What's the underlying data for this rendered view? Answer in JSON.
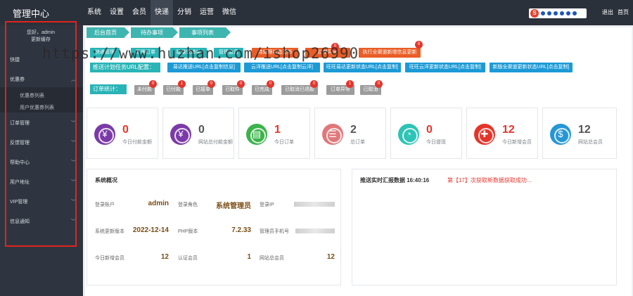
{
  "header": {
    "brand": "管理中心",
    "nav": [
      "系统",
      "设置",
      "会员",
      "快递",
      "分销",
      "运营",
      "微信"
    ],
    "active_nav": "快递",
    "right_links": [
      "退出",
      "首页"
    ]
  },
  "sidebar": {
    "greeting": "您好，admin",
    "refresh": "更新缓存",
    "quick": "快捷",
    "items": [
      {
        "label": "优惠券",
        "expanded": true
      },
      {
        "label": "订单管理"
      },
      {
        "label": "反馈管理"
      },
      {
        "label": "帮助中心"
      },
      {
        "label": "用户地址"
      },
      {
        "label": "VIP管理"
      },
      {
        "label": "信息通知"
      }
    ],
    "subitems": [
      "优惠券列表",
      "用户优惠券列表"
    ]
  },
  "breadcrumb": [
    "后台首页",
    "待办事项",
    "事项列表"
  ],
  "actions": {
    "row1": [
      {
        "label": "快递管理"
      },
      {
        "label": "管理订单"
      },
      {
        "label": "批量快递单"
      },
      {
        "label": "管理会员"
      },
      {
        "label": "待处理状态更新"
      },
      {
        "label": "拉单异常",
        "badge": "0"
      },
      {
        "label": "执行全渠道新增信息更新",
        "badge": "0"
      }
    ],
    "row2_label": "推送计划任务URL配置：",
    "row2": [
      "易达推送URL[点击复制信息]",
      "云洋推送URL[点击复制云洋]",
      "旺旺易达更新状态URL[点击复制]",
      "旺旺云洋更新状态URL[点击复制]",
      "新版全渠道更新状态URL[点击复制]"
    ]
  },
  "order_stats": {
    "label": "订单统计：",
    "items": [
      {
        "label": "未付款",
        "badge": "0"
      },
      {
        "label": "已付款",
        "badge": "1"
      },
      {
        "label": "已接单",
        "badge": "0"
      },
      {
        "label": "已取件",
        "badge": "0"
      },
      {
        "label": "已完成",
        "badge": "0"
      },
      {
        "label": "已取消已退款",
        "badge": "0"
      },
      {
        "label": "订单异常",
        "badge": "1"
      },
      {
        "label": "已取消",
        "badge": "0"
      }
    ]
  },
  "stats": [
    {
      "value": "0",
      "caption": "今日付款金额",
      "color": "#7b3aa8",
      "value_color": "#e5352b",
      "icon": "yen-icon",
      "glyph": "¥"
    },
    {
      "value": "0",
      "caption": "网站总付款金额",
      "color": "#7b3aa8",
      "value_color": "#555555",
      "icon": "yen-icon",
      "glyph": "¥"
    },
    {
      "value": "1",
      "caption": "今日订单",
      "color": "#3bb34a",
      "value_color": "#e5352b",
      "icon": "document-icon",
      "glyph": "▤"
    },
    {
      "value": "2",
      "caption": "总订单",
      "color": "#e0787a",
      "value_color": "#555555",
      "icon": "list-icon",
      "glyph": "☰"
    },
    {
      "value": "0",
      "caption": "今日提现",
      "color": "#2dc3b6",
      "value_color": "#e5352b",
      "icon": "pie-chart-icon",
      "glyph": "◔"
    },
    {
      "value": "12",
      "caption": "今日新增会员",
      "color": "#e5352b",
      "value_color": "#e5352b",
      "icon": "add-user-icon",
      "glyph": "✚"
    },
    {
      "value": "12",
      "caption": "网站总会员",
      "color": "#2596d6",
      "value_color": "#555555",
      "icon": "money-bag-icon",
      "glyph": "$"
    }
  ],
  "overview": {
    "title": "系统概况",
    "rows": [
      [
        {
          "k": "登录账户",
          "v": "admin"
        },
        {
          "k": "登录角色",
          "v": "系统管理员"
        },
        {
          "k": "登录IP",
          "v": ""
        }
      ],
      [
        {
          "k": "系统更新版本",
          "v": "2022-12-14"
        },
        {
          "k": "PHP版本",
          "v": "7.2.33"
        },
        {
          "k": "管理员手机号",
          "v": ""
        }
      ],
      [
        {
          "k": "今日新增会员",
          "v": "12"
        },
        {
          "k": "认证会员",
          "v": "1"
        },
        {
          "k": "网站总会员",
          "v": "12"
        }
      ]
    ]
  },
  "realtime": {
    "title": "推送实时汇报数据 16:40:16",
    "message": "第【17】次获取新数据获取成功..."
  },
  "watermark": "https://www.huzhan.com/ishop26990"
}
